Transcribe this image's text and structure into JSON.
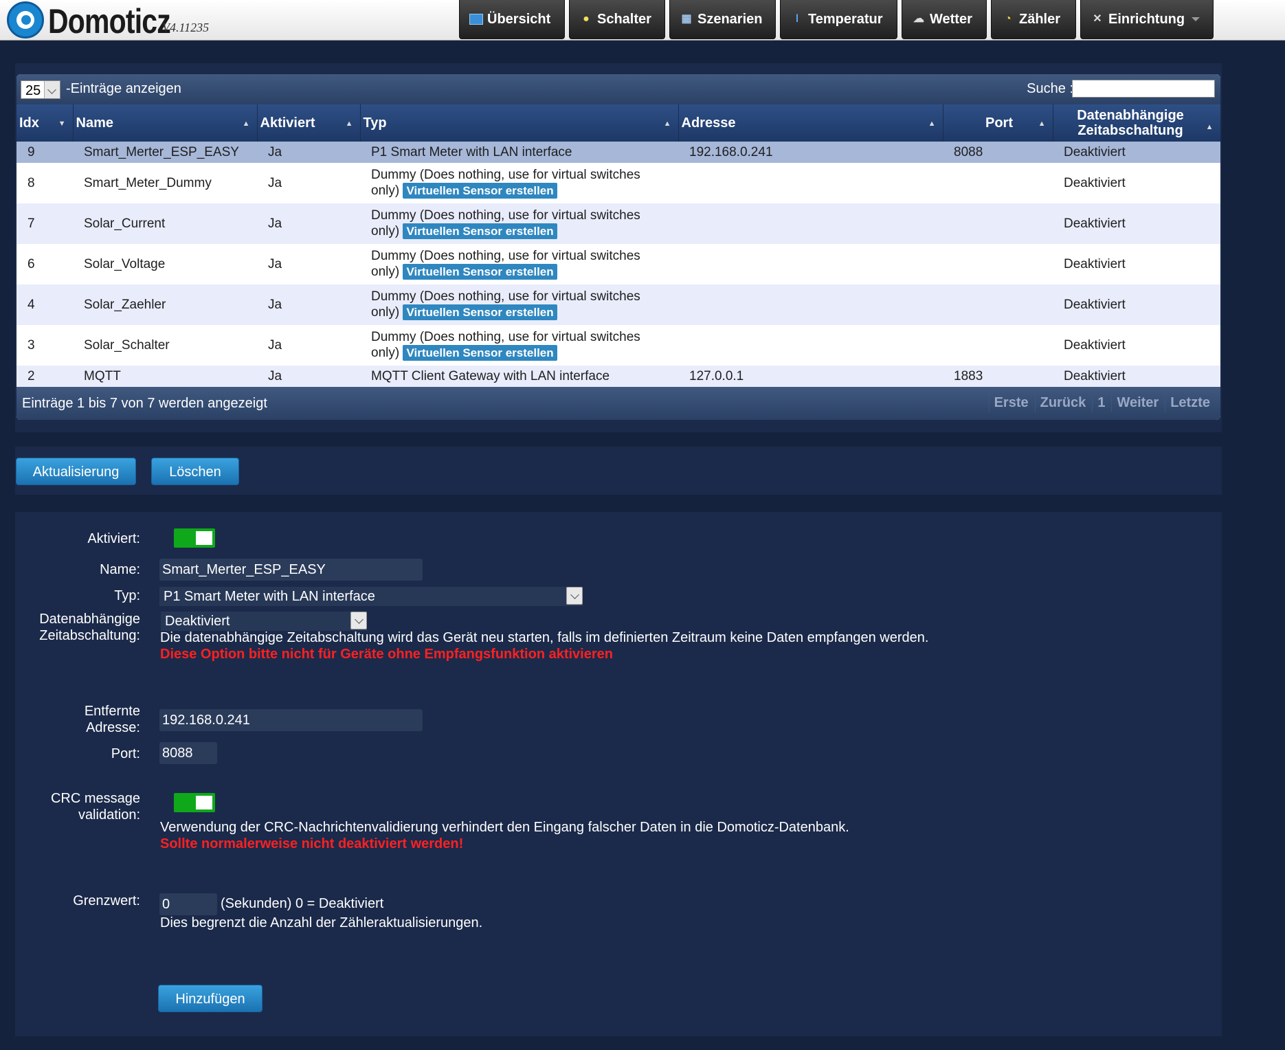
{
  "app": {
    "logo_text": "Domoticz",
    "version": "V4.11235"
  },
  "nav": [
    {
      "label": "Übersicht",
      "icon": "dashboard-icon"
    },
    {
      "label": "Schalter",
      "icon": "lightbulb-icon"
    },
    {
      "label": "Szenarien",
      "icon": "clapperboard-icon"
    },
    {
      "label": "Temperatur",
      "icon": "thermometer-icon"
    },
    {
      "label": "Wetter",
      "icon": "cloud-icon"
    },
    {
      "label": "Zähler",
      "icon": "gauge-icon"
    },
    {
      "label": "Einrichtung",
      "icon": "tools-icon"
    }
  ],
  "table": {
    "length_value": "25",
    "length_label": "-Einträge anzeigen",
    "search_label": "Suche :",
    "columns": [
      "Idx",
      "Name",
      "Aktiviert",
      "Typ",
      "Adresse",
      "Port",
      "Datenabhängige Zeitabschaltung"
    ],
    "dummy_type": "Dummy (Does nothing, use for virtual switches",
    "dummy_type_2": "only)",
    "virtual_button": "Virtuellen Sensor erstellen",
    "rows": [
      {
        "idx": "9",
        "name": "Smart_Merter_ESP_EASY",
        "enabled": "Ja",
        "type": "P1 Smart Meter with LAN interface",
        "address": "192.168.0.241",
        "port": "8088",
        "timeout": "Deaktiviert"
      },
      {
        "idx": "8",
        "name": "Smart_Meter_Dummy",
        "enabled": "Ja",
        "address": "",
        "port": "",
        "timeout": "Deaktiviert"
      },
      {
        "idx": "7",
        "name": "Solar_Current",
        "enabled": "Ja",
        "address": "",
        "port": "",
        "timeout": "Deaktiviert"
      },
      {
        "idx": "6",
        "name": "Solar_Voltage",
        "enabled": "Ja",
        "address": "",
        "port": "",
        "timeout": "Deaktiviert"
      },
      {
        "idx": "4",
        "name": "Solar_Zaehler",
        "enabled": "Ja",
        "address": "",
        "port": "",
        "timeout": "Deaktiviert"
      },
      {
        "idx": "3",
        "name": "Solar_Schalter",
        "enabled": "Ja",
        "address": "",
        "port": "",
        "timeout": "Deaktiviert"
      },
      {
        "idx": "2",
        "name": "MQTT",
        "enabled": "Ja",
        "type": "MQTT Client Gateway with LAN interface",
        "address": "127.0.0.1",
        "port": "1883",
        "timeout": "Deaktiviert"
      }
    ],
    "info": "Einträge 1 bis 7 von 7 werden angezeigt",
    "pager": [
      "Erste",
      "Zurück",
      "1",
      "Weiter",
      "Letzte"
    ]
  },
  "actions": {
    "update": "Aktualisierung",
    "delete": "Löschen"
  },
  "form": {
    "enabled_label": "Aktiviert:",
    "enabled_value": true,
    "name_label": "Name:",
    "name_value": "Smart_Merter_ESP_EASY",
    "type_label": "Typ:",
    "type_value": "P1 Smart Meter with LAN interface",
    "timeout_label_1": "Datenabhängige",
    "timeout_label_2": "Zeitabschaltung:",
    "timeout_value": "Deaktiviert",
    "timeout_help": "Die datenabhängige Zeitabschaltung wird das Gerät neu starten, falls im definierten Zeitraum keine Daten empfangen werden.",
    "timeout_warning": "Diese Option bitte nicht für Geräte ohne Empfangsfunktion aktivieren",
    "address_label_1": "Entfernte",
    "address_label_2": "Adresse:",
    "address_value": "192.168.0.241",
    "port_label": "Port:",
    "port_value": "8088",
    "crc_label_1": "CRC message",
    "crc_label_2": "validation:",
    "crc_value": true,
    "crc_help": "Verwendung der CRC-Nachrichtenvalidierung verhindert den Eingang falscher Daten in die Domoticz-Datenbank.",
    "crc_warning": "Sollte normalerweise nicht deaktiviert werden!",
    "limit_label": "Grenzwert:",
    "limit_value": "0",
    "limit_unit": "(Sekunden) 0 = Deaktiviert",
    "limit_help": "Dies begrenzt die Anzahl der Zähleraktualisierungen.",
    "add_button": "Hinzufügen"
  },
  "colors": {
    "background": "#15223d",
    "panel": "#1b2a4a",
    "accent": "#2f87c0",
    "toggle_on": "#0fa81a",
    "warning": "#ff2020"
  }
}
